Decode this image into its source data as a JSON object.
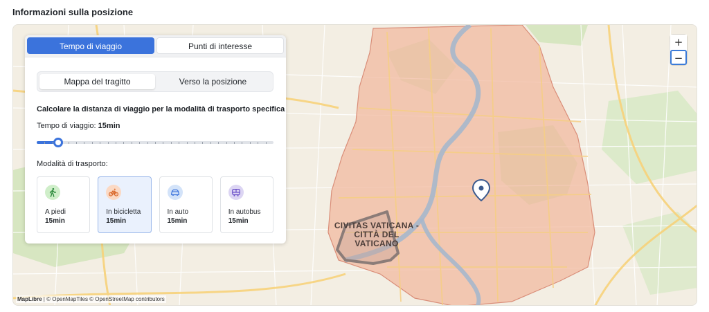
{
  "section": {
    "title": "Informazioni sulla posizione"
  },
  "panel": {
    "top_tabs": [
      {
        "label": "Tempo di viaggio",
        "active": true
      },
      {
        "label": "Punti di interesse",
        "active": false
      }
    ],
    "sub_tabs": [
      {
        "label": "Mappa del tragitto",
        "active": true
      },
      {
        "label": "Verso la posizione",
        "active": false
      }
    ],
    "description": "Calcolare la distanza di viaggio per la modalità di trasporto specifica",
    "travel_time_label": "Tempo di viaggio:",
    "travel_time_value": "15min",
    "slider": {
      "value_fraction": 0.09,
      "tick_count": 30
    },
    "modes_label": "Modalità di trasporto:",
    "modes": [
      {
        "label": "A piedi",
        "value": "15min",
        "icon": "walk-icon",
        "icon_bg": "#cfeec9",
        "icon_color": "#2e8b3e",
        "active": false
      },
      {
        "label": "In bicicletta",
        "value": "15min",
        "icon": "bike-icon",
        "icon_bg": "#fbd9c4",
        "icon_color": "#d9682b",
        "active": true
      },
      {
        "label": "In auto",
        "value": "15min",
        "icon": "car-icon",
        "icon_bg": "#d3e3f9",
        "icon_color": "#3b73dc",
        "active": false
      },
      {
        "label": "In autobus",
        "value": "15min",
        "icon": "bus-icon",
        "icon_bg": "#dcd5f3",
        "icon_color": "#6a4fc8",
        "active": false
      }
    ]
  },
  "map": {
    "zoom_in": "+",
    "zoom_out": "−",
    "place_label": "CIVITAS VATICANA - CITTÀ DEL VATICANO",
    "attribution_brand": "MapLibre",
    "attribution_rest": "| © OpenMapTiles © OpenStreetMap contributors",
    "accent_color": "#3b73dc",
    "isochrone_color": "#f2b9a0"
  }
}
